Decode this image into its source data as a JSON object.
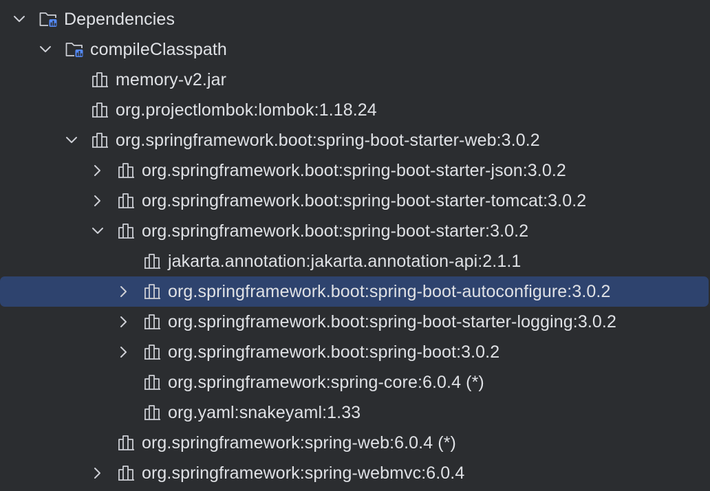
{
  "colors": {
    "background": "#2b2d30",
    "text": "#dfe1e5",
    "selection": "#2e436e",
    "icon_stroke": "#ced0d6",
    "module_badge": "#548af7"
  },
  "tree": {
    "root": {
      "label": "Dependencies",
      "icon": "dependencies-folder-icon",
      "expanded": true
    },
    "config": {
      "label": "compileClasspath",
      "icon": "configuration-folder-icon",
      "expanded": true
    },
    "items": [
      {
        "label": "memory-v2.jar",
        "icon": "library-icon"
      },
      {
        "label": "org.projectlombok:lombok:1.18.24",
        "icon": "library-icon"
      },
      {
        "label": "org.springframework.boot:spring-boot-starter-web:3.0.2",
        "icon": "library-icon",
        "expanded": true
      },
      {
        "label": "org.springframework.boot:spring-boot-starter-json:3.0.2",
        "icon": "library-icon",
        "expanded": false
      },
      {
        "label": "org.springframework.boot:spring-boot-starter-tomcat:3.0.2",
        "icon": "library-icon",
        "expanded": false
      },
      {
        "label": "org.springframework.boot:spring-boot-starter:3.0.2",
        "icon": "library-icon",
        "expanded": true
      },
      {
        "label": "jakarta.annotation:jakarta.annotation-api:2.1.1",
        "icon": "library-icon"
      },
      {
        "label": "org.springframework.boot:spring-boot-autoconfigure:3.0.2",
        "icon": "library-icon",
        "expanded": false,
        "selected": true
      },
      {
        "label": "org.springframework.boot:spring-boot-starter-logging:3.0.2",
        "icon": "library-icon",
        "expanded": false
      },
      {
        "label": "org.springframework.boot:spring-boot:3.0.2",
        "icon": "library-icon",
        "expanded": false
      },
      {
        "label": "org.springframework:spring-core:6.0.4 (*)",
        "icon": "library-icon"
      },
      {
        "label": "org.yaml:snakeyaml:1.33",
        "icon": "library-icon"
      },
      {
        "label": "org.springframework:spring-web:6.0.4 (*)",
        "icon": "library-icon"
      },
      {
        "label": "org.springframework:spring-webmvc:6.0.4",
        "icon": "library-icon",
        "expanded": false
      }
    ]
  }
}
